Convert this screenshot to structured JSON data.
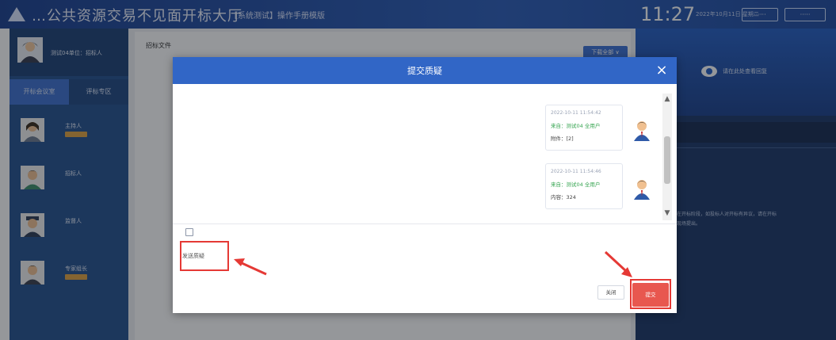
{
  "header": {
    "title": "…公共资源交易不见面开标大厅",
    "subtitle": "【系统测试】操作手册模版",
    "clock": "11:27",
    "date_text": "2022年10月11日 星期二",
    "buttons": [
      "······",
      "·····"
    ]
  },
  "sidebar": {
    "user_name": "测试04单位：招标人",
    "tabs": [
      "开标会议室",
      "评标专区"
    ],
    "roles": [
      {
        "name": "主持人"
      },
      {
        "name": "招标人"
      },
      {
        "name": "监督人"
      },
      {
        "name": "专家组长"
      }
    ]
  },
  "main": {
    "title": "招标文件",
    "top_button": "下载全部 ∨"
  },
  "right_panel": {
    "header_text": "请在此处查看回复",
    "lines": [
      "在开标阶段，如投标人对开标有异议，请在开标",
      "现场提出。"
    ]
  },
  "modal": {
    "title": "提交质疑",
    "close": "×",
    "messages": [
      {
        "time": "2022-10-11 11:54:42",
        "sender": "来自：测试04 全用户",
        "content": "附件：[2]"
      },
      {
        "time": "2022-10-11 11:54:46",
        "sender": "来自：测试04 全用户",
        "content": "内容：324"
      }
    ],
    "input_value": "发送质疑",
    "cancel_label": "关闭",
    "submit_label": "提交"
  },
  "colors": {
    "header": "#1e4aa0",
    "modal_header": "#3166c6",
    "submit": "#e8574f",
    "annotation": "#e53935"
  }
}
